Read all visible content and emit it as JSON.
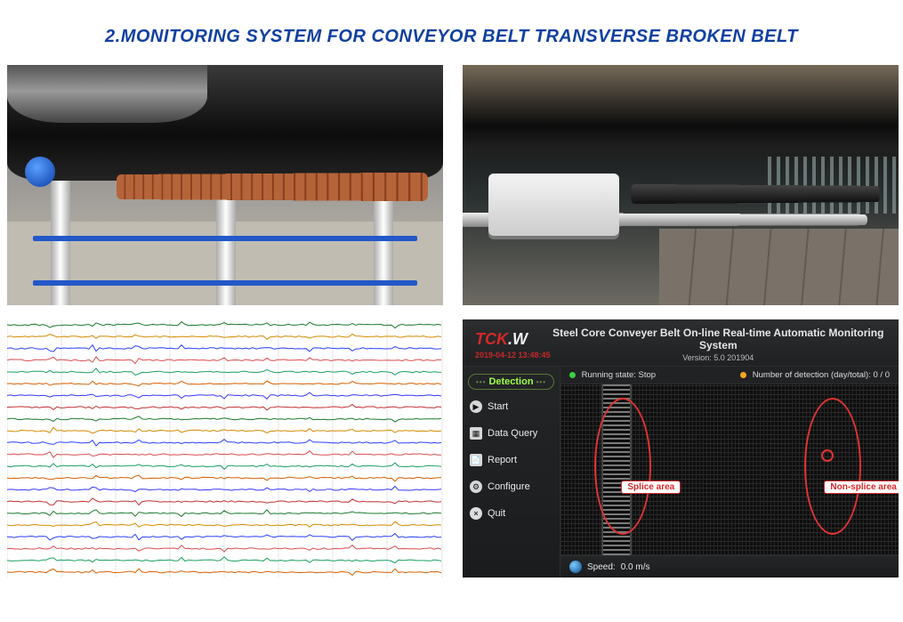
{
  "title": "2.MONITORING SYSTEM FOR CONVEYOR BELT TRANSVERSE BROKEN BELT",
  "app": {
    "logo_a": "TCK",
    "logo_b": ".W",
    "datetime": "2019-04-12 13:48:45",
    "title": "Steel Core Conveyer Belt On-line Real-time Automatic Monitoring System",
    "version": "Version: 5.0 201904",
    "detection_label": "Detection",
    "menu": {
      "start": "Start",
      "dataquery": "Data Query",
      "report": "Report",
      "configure": "Configure",
      "quit": "Quit"
    },
    "status": {
      "running_label": "Running state:",
      "running_value": "Stop",
      "detect_label": "Number of detection (day/total):",
      "detect_value": "0 / 0"
    },
    "annotations": {
      "splice": "Splice area",
      "nonsplice": "Non-splice area"
    },
    "footer": {
      "speed_label": "Speed:",
      "speed_value": "0.0 m/s"
    }
  }
}
